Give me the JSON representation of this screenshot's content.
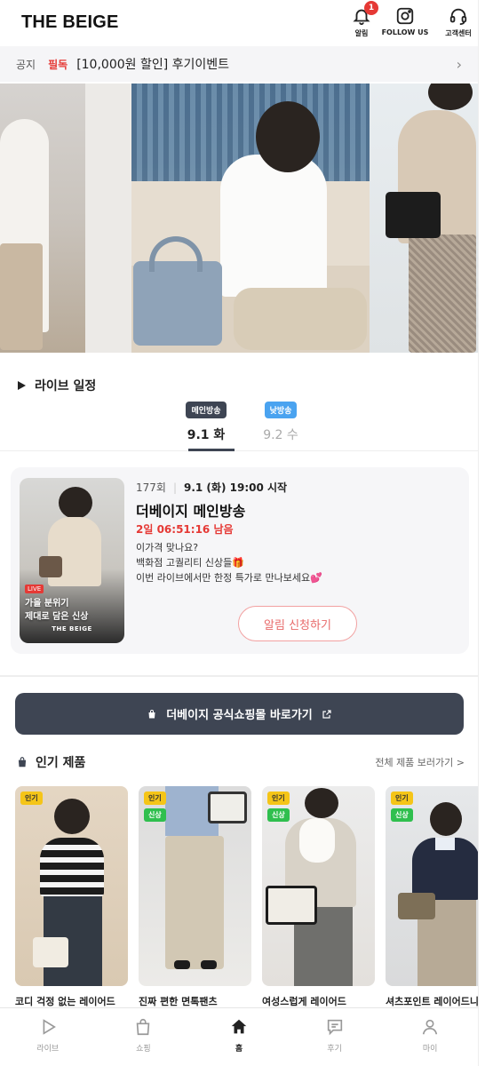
{
  "header": {
    "brand": "THE BEIGE",
    "alarm_label": "알림",
    "alarm_badge": "1",
    "follow_label": "FOLLOW US",
    "support_label": "고객센터"
  },
  "notice": {
    "label": "공지",
    "tag": "필독",
    "text": "[10,000원 할인] 후기이벤트"
  },
  "live": {
    "title": "라이브 일정",
    "tabs": [
      {
        "pill": "메인방송",
        "date": "9.1 화",
        "active": true
      },
      {
        "pill": "낮방송",
        "date": "9.2 수",
        "active": false
      }
    ]
  },
  "broadcast": {
    "episode": "177회",
    "when": "9.1 (화) 19:00 시작",
    "title": "더베이지 메인방송",
    "countdown": "2일 06:51:16 남음",
    "desc_1": "이가격 맞나요?",
    "desc_2": "백화점 고퀄리티 신상들🎁",
    "desc_3": "이번 라이브에서만 한정 특가로 만나보세요💕",
    "notify_button": "알림 신청하기",
    "thumb_live": "LIVE",
    "thumb_line_1": "가을 분위기",
    "thumb_line_2": "제대로 담은 신상",
    "thumb_brand": "THE BEIGE"
  },
  "mall_button": "더베이지 공식쇼핑몰 바로가기",
  "popular": {
    "title": "인기 제품",
    "see_all": "전체 제품 보러가기 >",
    "products": [
      {
        "name": "코디 걱정 없는 레이어드",
        "tags": [
          "인기"
        ]
      },
      {
        "name": "진짜 편한 면톡팬츠",
        "tags": [
          "인기",
          "신상"
        ]
      },
      {
        "name": "여성스럽게 레이어드",
        "tags": [
          "인기",
          "신상"
        ]
      },
      {
        "name": "셔츠포인트 레이어드니트",
        "tags": [
          "인기",
          "신상"
        ]
      }
    ]
  },
  "tabbar": {
    "items": [
      {
        "label": "라이브",
        "icon": "play-icon"
      },
      {
        "label": "쇼핑",
        "icon": "shopping-bag-icon"
      },
      {
        "label": "홈",
        "icon": "home-icon",
        "active": true
      },
      {
        "label": "후기",
        "icon": "chat-icon"
      },
      {
        "label": "마이",
        "icon": "user-icon"
      }
    ]
  }
}
